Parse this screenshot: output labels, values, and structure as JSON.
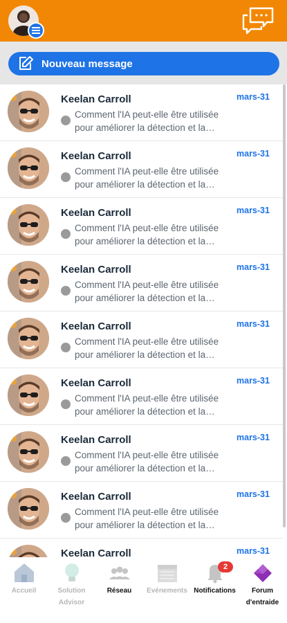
{
  "header": {
    "colors": {
      "bar": "#F28705",
      "accent": "#1E73E6"
    },
    "profile_icon": "user-avatar",
    "menu_icon": "menu-icon",
    "chat_icon": "chat-bubbles-icon"
  },
  "new_message": {
    "label": "Nouveau message",
    "icon": "edit-icon"
  },
  "conversations": [
    {
      "name": "Keelan Carroll",
      "date": "mars-31",
      "preview": "Comment l'IA peut-elle être utilisée pour améliorer la détection et la…"
    },
    {
      "name": "Keelan Carroll",
      "date": "mars-31",
      "preview": "Comment l'IA peut-elle être utilisée pour améliorer la détection et la…"
    },
    {
      "name": "Keelan Carroll",
      "date": "mars-31",
      "preview": "Comment l'IA peut-elle être utilisée pour améliorer la détection et la…"
    },
    {
      "name": "Keelan Carroll",
      "date": "mars-31",
      "preview": "Comment l'IA peut-elle être utilisée pour améliorer la détection et la…"
    },
    {
      "name": "Keelan Carroll",
      "date": "mars-31",
      "preview": "Comment l'IA peut-elle être utilisée pour améliorer la détection et la…"
    },
    {
      "name": "Keelan Carroll",
      "date": "mars-31",
      "preview": "Comment l'IA peut-elle être utilisée pour améliorer la détection et la…"
    },
    {
      "name": "Keelan Carroll",
      "date": "mars-31",
      "preview": "Comment l'IA peut-elle être utilisée pour améliorer la détection et la…"
    },
    {
      "name": "Keelan Carroll",
      "date": "mars-31",
      "preview": "Comment l'IA peut-elle être utilisée pour améliorer la détection et la…"
    },
    {
      "name": "Keelan Carroll",
      "date": "mars-31",
      "preview": ""
    }
  ],
  "bottom_nav": [
    {
      "label": "Accueil",
      "icon": "home-icon",
      "active": false
    },
    {
      "label": "Solution Advisor",
      "icon": "lightbulb-icon",
      "active": false
    },
    {
      "label": "Réseau",
      "icon": "people-icon",
      "active": true
    },
    {
      "label": "Evénements",
      "icon": "calendar-icon",
      "active": false
    },
    {
      "label": "Notifications",
      "icon": "bell-icon",
      "active": true,
      "badge": "2"
    },
    {
      "label": "Forum d'entraide",
      "icon": "forum-icon",
      "active": true
    }
  ]
}
